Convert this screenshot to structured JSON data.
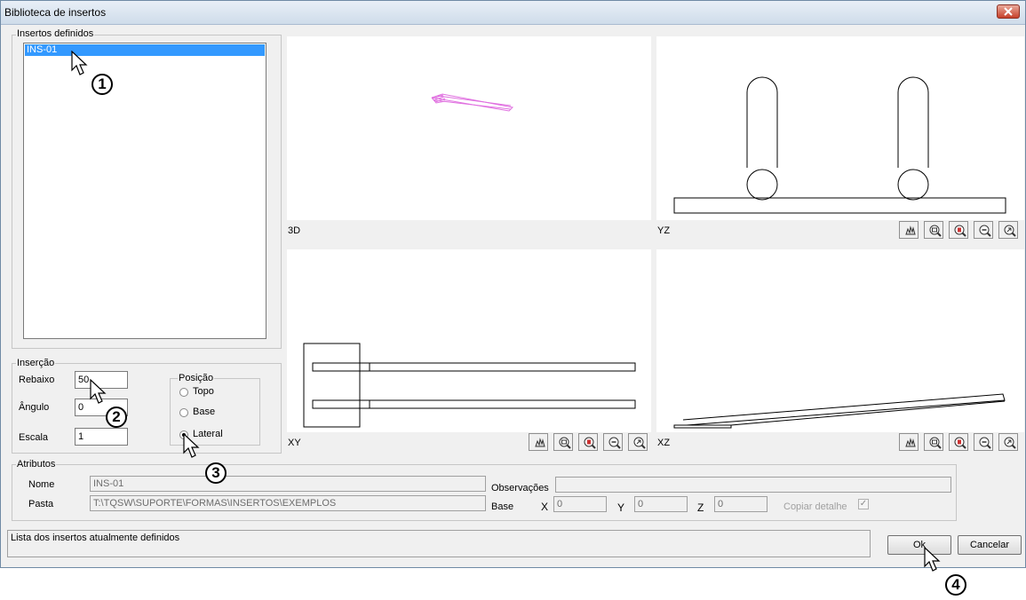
{
  "window": {
    "title": "Biblioteca de insertos"
  },
  "inserts_list": {
    "legend": "Insertos definidos",
    "items": [
      "INS-01"
    ],
    "selected": "INS-01"
  },
  "insertion": {
    "legend": "Inserção",
    "rebaixo": {
      "label": "Rebaixo",
      "value": "50"
    },
    "angulo": {
      "label": "Ângulo",
      "value": "0"
    },
    "escala": {
      "label": "Escala",
      "value": "1"
    },
    "position": {
      "legend": "Posição",
      "options": [
        "Topo",
        "Base",
        "Lateral"
      ],
      "selected": "Lateral"
    }
  },
  "views": {
    "v3d": "3D",
    "yz": "YZ",
    "xy": "XY",
    "xz": "XZ"
  },
  "toolbar_icons": [
    "pan-icon",
    "zoom-window-icon",
    "zoom-all-icon",
    "zoom-out-icon",
    "zoom-previous-icon"
  ],
  "attributes": {
    "legend": "Atributos",
    "nome": {
      "label": "Nome",
      "value": "INS-01"
    },
    "pasta": {
      "label": "Pasta",
      "value": "T:\\TQSW\\SUPORTE\\FORMAS\\INSERTOS\\EXEMPLOS"
    },
    "observacoes": {
      "label": "Observações",
      "value": ""
    },
    "base": {
      "label": "Base",
      "x_label": "X",
      "x": "0",
      "y_label": "Y",
      "y": "0",
      "z_label": "Z",
      "z": "0"
    },
    "copiar": {
      "label": "Copiar detalhe",
      "checked": true
    }
  },
  "status": {
    "text": "Lista dos insertos atualmente definidos"
  },
  "buttons": {
    "ok": "Ok",
    "cancel": "Cancelar"
  },
  "steps": [
    "1",
    "2",
    "3",
    "4"
  ],
  "colors": {
    "selection": "#3399ff",
    "insert_3d": "#e070e0"
  }
}
